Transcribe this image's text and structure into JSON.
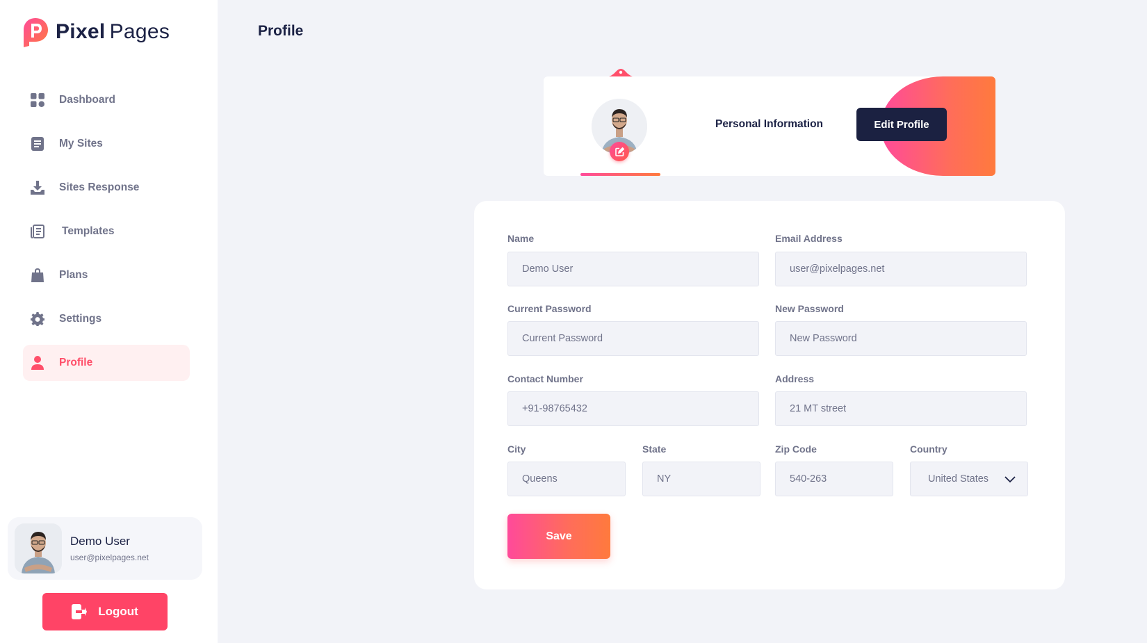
{
  "brand": {
    "name_bold": "Pixel",
    "name_light": "Pages"
  },
  "sidebar": {
    "items": [
      {
        "label": "Dashboard",
        "icon": "grid-icon"
      },
      {
        "label": "My Sites",
        "icon": "document-icon"
      },
      {
        "label": "Sites Response",
        "icon": "download-icon"
      },
      {
        "label": "Templates",
        "icon": "templates-icon"
      },
      {
        "label": "Plans",
        "icon": "bag-icon"
      },
      {
        "label": "Settings",
        "icon": "gear-icon"
      },
      {
        "label": "Profile",
        "icon": "user-icon",
        "active": true
      }
    ],
    "user": {
      "name": "Demo User",
      "email": "user@pixelpages.net"
    },
    "logout_label": "Logout"
  },
  "page": {
    "title": "Profile"
  },
  "personal_info": {
    "title": "Personal Information",
    "edit_label": "Edit Profile"
  },
  "form": {
    "name": {
      "label": "Name",
      "value": "Demo User"
    },
    "email": {
      "label": "Email Address",
      "value": "user@pixelpages.net"
    },
    "current_password": {
      "label": "Current Password",
      "placeholder": "Current Password"
    },
    "new_password": {
      "label": "New Password",
      "placeholder": "New Password"
    },
    "contact": {
      "label": "Contact Number",
      "value": "+91-98765432"
    },
    "address": {
      "label": "Address",
      "value": "21 MT street"
    },
    "city": {
      "label": "City",
      "value": "Queens"
    },
    "state": {
      "label": "State",
      "value": "NY"
    },
    "zip": {
      "label": "Zip Code",
      "value": "540-263"
    },
    "country": {
      "label": "Country",
      "value": "United States"
    },
    "save_label": "Save"
  },
  "colors": {
    "accent": "#ff4f6a",
    "navy": "#1b2141",
    "gradient_start": "#ff4a9a",
    "gradient_end": "#ff7a3d"
  }
}
